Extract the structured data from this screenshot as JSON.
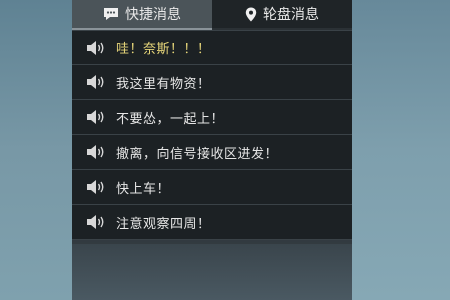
{
  "tabs": [
    {
      "label": "快捷消息",
      "icon": "chat-bubble-icon",
      "active": true
    },
    {
      "label": "轮盘消息",
      "icon": "map-pin-icon",
      "active": false
    }
  ],
  "messages": [
    {
      "label": "哇！奈斯！！！",
      "icon": "speaker-icon",
      "highlight": true
    },
    {
      "label": "我这里有物资！",
      "icon": "speaker-icon"
    },
    {
      "label": "不要怂，一起上！",
      "icon": "speaker-icon"
    },
    {
      "label": "撤离，向信号接收区进发！",
      "icon": "speaker-icon"
    },
    {
      "label": "快上车！",
      "icon": "speaker-icon"
    },
    {
      "label": "注意观察四周！",
      "icon": "speaker-icon"
    }
  ],
  "colors": {
    "highlight_text": "#e8d77a",
    "text": "#e6e6e6",
    "panel_bg": "#1c2124",
    "active_tab": "#4b5459"
  }
}
